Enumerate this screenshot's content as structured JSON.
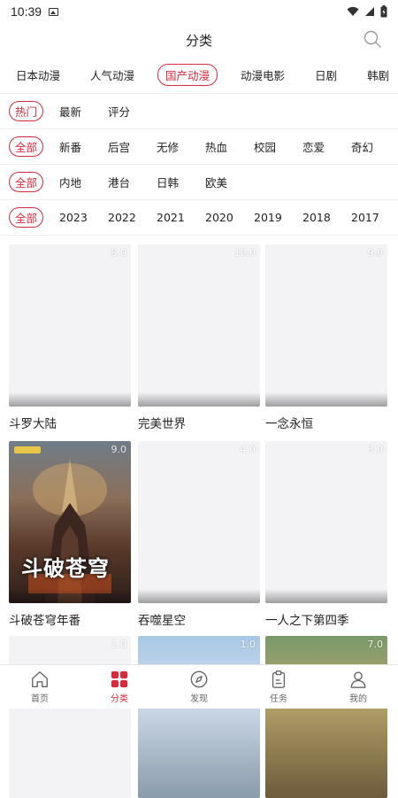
{
  "status": {
    "time": "10:39"
  },
  "header": {
    "title": "分类"
  },
  "categories": [
    "日本动漫",
    "人气动漫",
    "国产动漫",
    "动漫电影",
    "日剧",
    "韩剧"
  ],
  "active_category": 2,
  "filters": {
    "sort": [
      "热门",
      "最新",
      "评分"
    ],
    "genre": [
      "全部",
      "新番",
      "后宫",
      "无修",
      "热血",
      "校园",
      "恋爱",
      "奇幻"
    ],
    "region": [
      "全部",
      "内地",
      "港台",
      "日韩",
      "欧美"
    ],
    "year": [
      "全部",
      "2023",
      "2022",
      "2021",
      "2020",
      "2019",
      "2018",
      "2017"
    ]
  },
  "cards": [
    {
      "title": "斗罗大陆",
      "score": "8.0"
    },
    {
      "title": "完美世界",
      "score": "10.0"
    },
    {
      "title": "一念永恒",
      "score": "9.0"
    },
    {
      "title": "斗破苍穹年番",
      "score": "9.0",
      "poster_text": "斗破苍穹"
    },
    {
      "title": "吞噬星空",
      "score": "4.0"
    },
    {
      "title": "一人之下第四季",
      "score": "3.0"
    },
    {
      "title": "",
      "score": "1.0"
    },
    {
      "title": "",
      "score": "1.0"
    },
    {
      "title": "",
      "score": "7.0"
    }
  ],
  "tabbar": [
    {
      "label": "首页",
      "icon": "home-icon"
    },
    {
      "label": "分类",
      "icon": "category-icon"
    },
    {
      "label": "发现",
      "icon": "compass-icon"
    },
    {
      "label": "任务",
      "icon": "clipboard-icon"
    },
    {
      "label": "我的",
      "icon": "user-icon"
    }
  ],
  "colors": {
    "accent": "#d62b3d"
  }
}
